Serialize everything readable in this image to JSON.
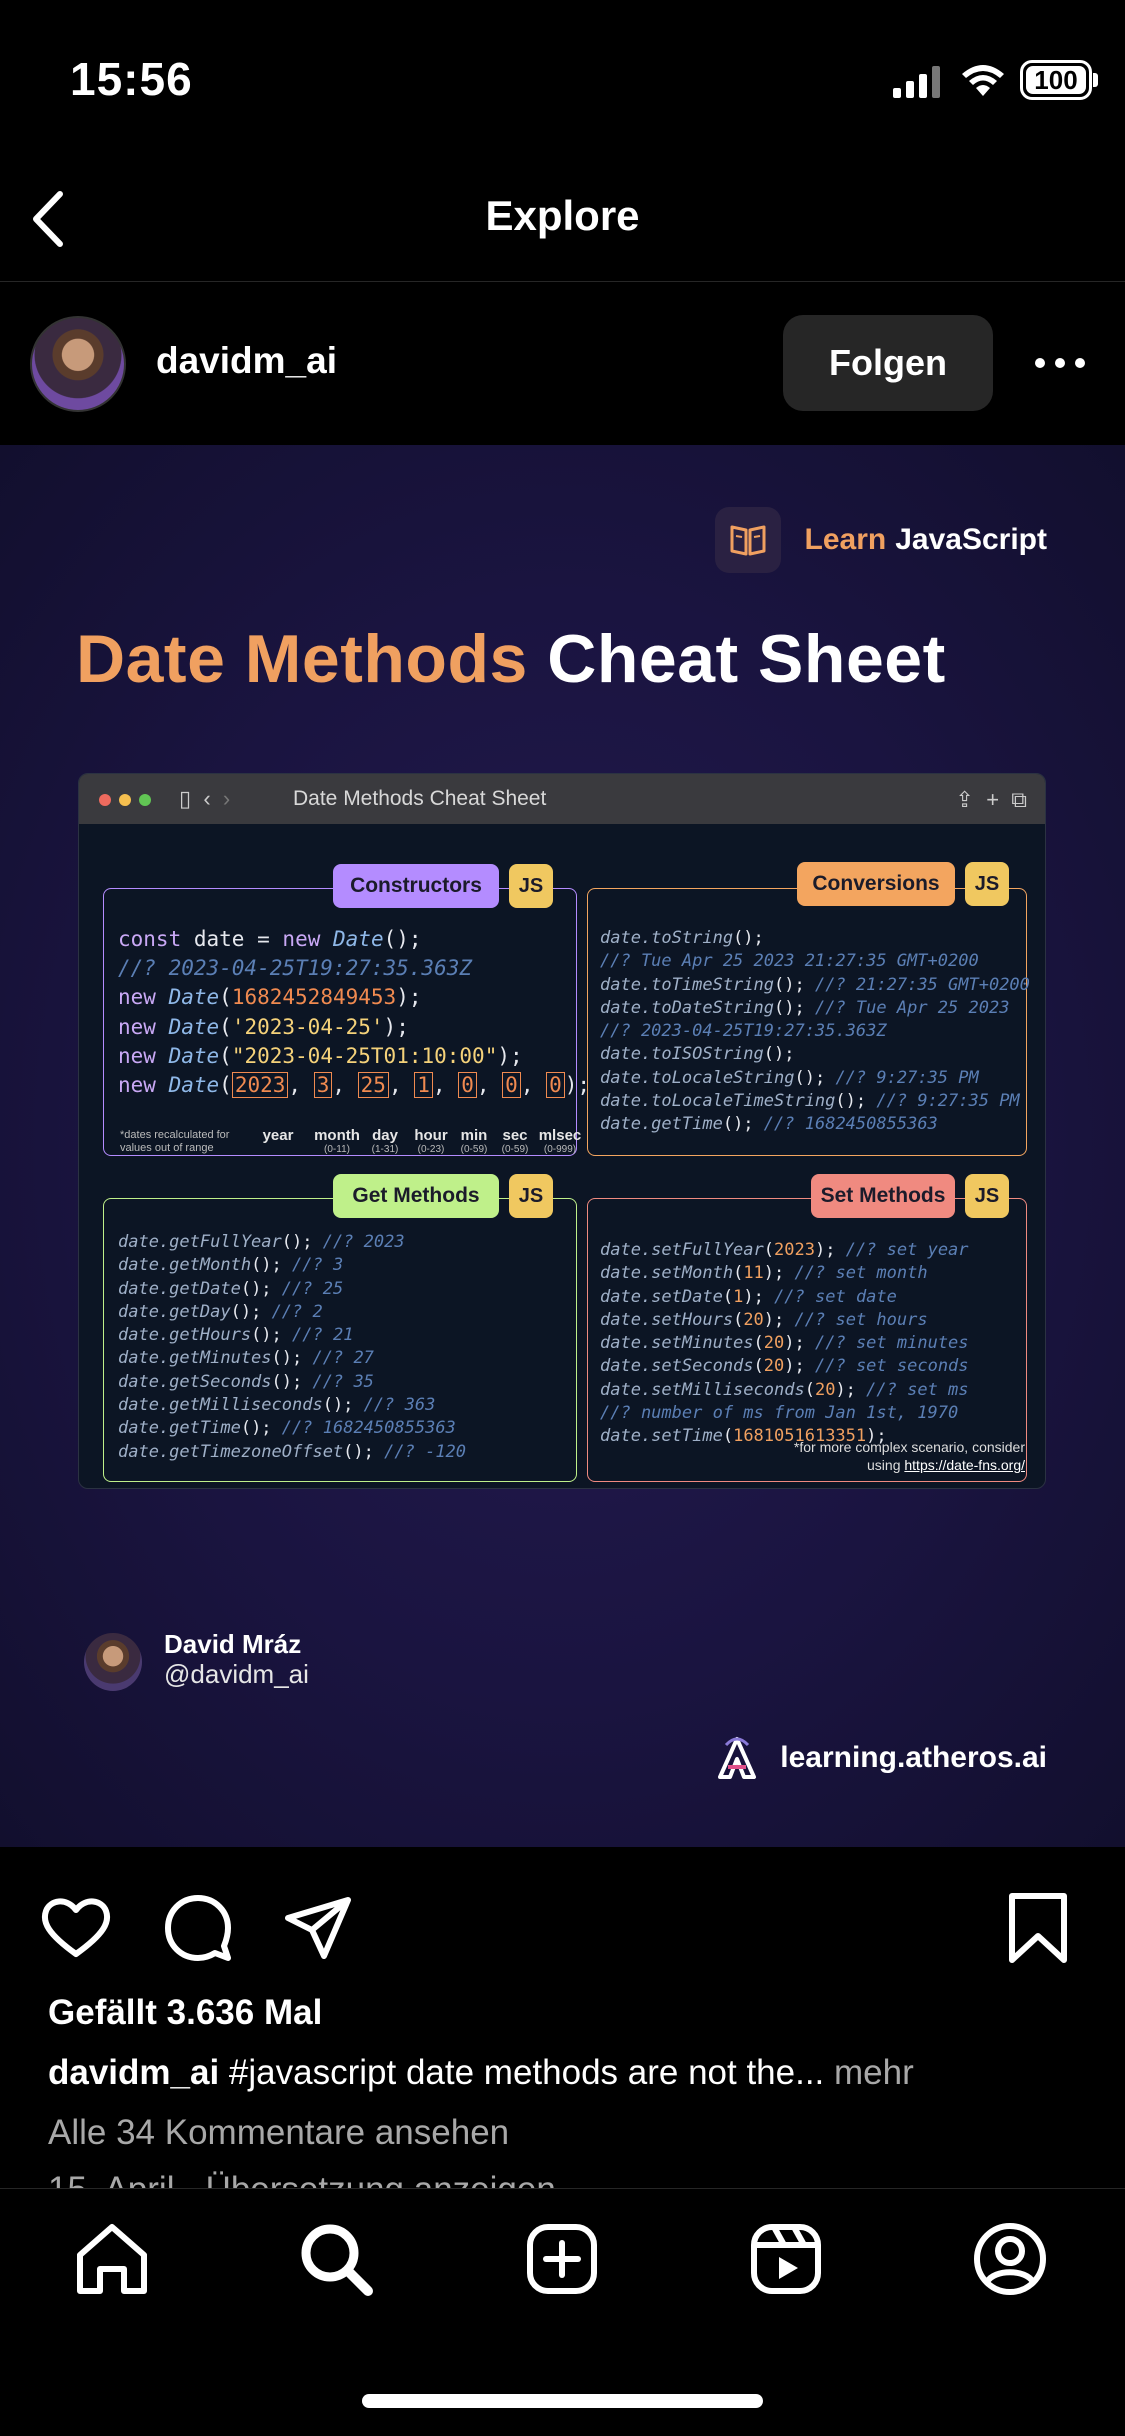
{
  "status": {
    "time": "15:56",
    "battery": "100"
  },
  "nav": {
    "title": "Explore"
  },
  "post_header": {
    "username": "davidm_ai",
    "follow_label": "Folgen"
  },
  "post_image": {
    "badge_learn": "Learn",
    "badge_js": "JavaScript",
    "title_accent": "Date Methods",
    "title_rest": "Cheat Sheet",
    "window_title": "Date Methods Cheat Sheet",
    "constructors": {
      "tag": "Constructors",
      "js": "JS",
      "labels": [
        {
          "name": "year",
          "range": ""
        },
        {
          "name": "month",
          "range": "(0-11)"
        },
        {
          "name": "day",
          "range": "(1-31)"
        },
        {
          "name": "hour",
          "range": "(0-23)"
        },
        {
          "name": "min",
          "range": "(0-59)"
        },
        {
          "name": "sec",
          "range": "(0-59)"
        },
        {
          "name": "mlsec",
          "range": "(0-999)"
        }
      ],
      "footnote": "*dates recalculated for values out of range"
    },
    "conversions": {
      "tag": "Conversions",
      "js": "JS",
      "lines": [
        "date.toString();",
        "//? Tue Apr 25 2023 21:27:35 GMT+0200",
        "date.toTimeString(); //? 21:27:35 GMT+0200",
        "date.toDateString(); //? Tue Apr 25 2023",
        "//? 2023-04-25T19:27:35.363Z",
        "date.toISOString();",
        "date.toLocaleString(); //? 9:27:35 PM",
        "date.toLocaleTimeString(); //? 9:27:35 PM",
        "date.getTime(); //? 1682450855363"
      ]
    },
    "get_methods": {
      "tag": "Get Methods",
      "js": "JS",
      "lines": [
        "date.getFullYear(); //? 2023",
        "date.getMonth(); //? 3",
        "date.getDate(); //? 25",
        "date.getDay(); //? 2",
        "date.getHours(); //? 21",
        "date.getMinutes(); //? 27",
        "date.getSeconds(); //? 35",
        "date.getMilliseconds(); //? 363",
        "date.getTime(); //? 1682450855363",
        "date.getTimezoneOffset(); //? -120"
      ]
    },
    "set_methods": {
      "tag": "Set Methods",
      "js": "JS",
      "lines": [
        "date.setFullYear(2023); //? set year",
        "date.setMonth(11); //? set month",
        "date.setDate(1); //? set date",
        "date.setHours(20); //? set hours",
        "date.setMinutes(20); //? set minutes",
        "date.setSeconds(20); //? set seconds",
        "date.setMilliseconds(20); //? set ms",
        "//? number of ms from Jan 1st, 1970",
        "date.setTime(1681051613351);"
      ]
    },
    "footnote": "*for more complex scenario, consider",
    "footnote_link_prefix": "using",
    "footnote_link": "https://date-fns.org/",
    "author_name": "David Mráz",
    "author_handle": "@davidm_ai",
    "site": "learning.atheros.ai"
  },
  "actions": {
    "likes": "Gefällt 3.636 Mal",
    "caption_user": "davidm_ai",
    "caption_text": " #javascript date methods are not the...",
    "caption_more": " mehr",
    "comments_link": "Alle 34 Kommentare ansehen",
    "peek_text": "15. April · Übersetzung anzeigen"
  },
  "colors": {
    "accent_orange": "#f0a060",
    "constructors": "#b48cff",
    "conversions": "#f3a55f",
    "get": "#bff08a",
    "set": "#f08a80"
  }
}
